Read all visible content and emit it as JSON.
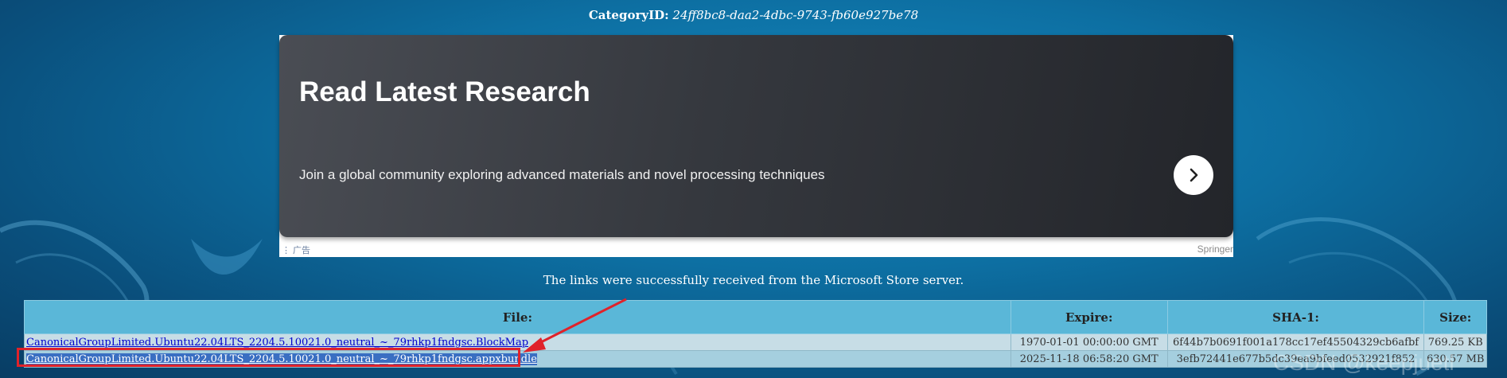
{
  "header": {
    "category_label": "CategoryID:",
    "category_id": "24ff8bc8-daa2-4dbc-9743-fb60e927be78"
  },
  "ad": {
    "title": "Read Latest Research",
    "description": "Join a global community exploring advanced materials and novel processing techniques",
    "label": "⋮ 广告",
    "brand": "Springer",
    "arrow_icon": "chevron-right-icon"
  },
  "status": {
    "message": "The links were successfully received from the Microsoft Store server."
  },
  "table": {
    "headers": [
      "File:",
      "Expire:",
      "SHA-1:",
      "Size:"
    ],
    "rows": [
      {
        "file": "CanonicalGroupLimited.Ubuntu22.04LTS_2204.5.10021.0_neutral_~_79rhkp1fndgsc.BlockMap",
        "expire": "1970-01-01 00:00:00 GMT",
        "sha1": "6f44b7b0691f001a178cc17ef45504329cb6afbf",
        "size": "769.25 KB"
      },
      {
        "file": "CanonicalGroupLimited.Ubuntu22.04LTS_2204.5.10021.0_neutral_~_79rhkp1fndgsc.appxbundle",
        "expire": "2025-11-18 06:58:20 GMT",
        "sha1": "3efb72441e677b5dc39ea9bfeed0532921f852",
        "size": "630.57 MB"
      }
    ]
  },
  "annotation": {
    "color": "#e0222a"
  },
  "watermark": {
    "text": "CSDN @keepjuetl"
  }
}
